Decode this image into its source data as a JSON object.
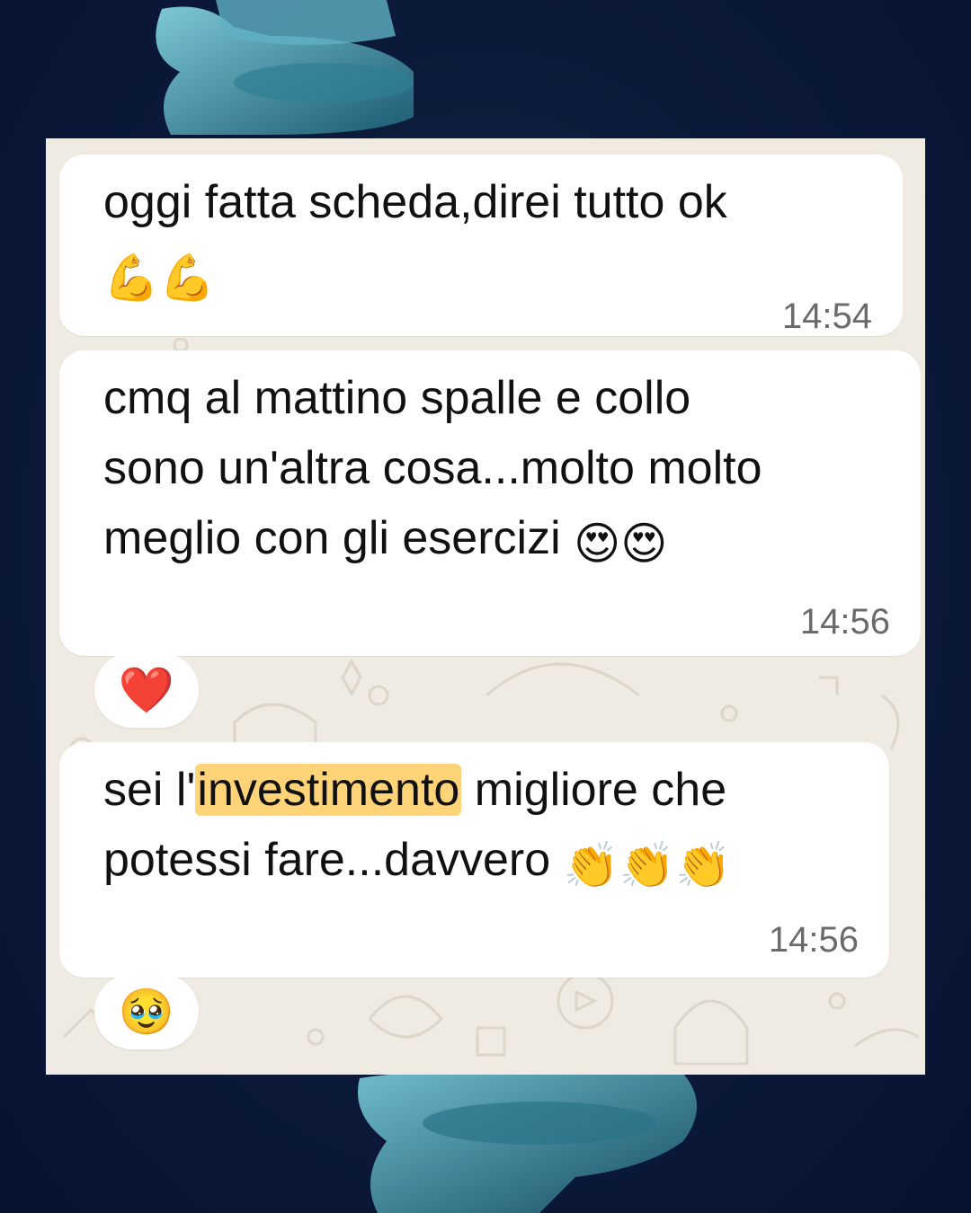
{
  "messages": [
    {
      "text": "oggi fatta scheda,direi tutto  ok",
      "emoji": "💪💪",
      "time": "14:54"
    },
    {
      "text": "cmq al mattino spalle e collo\nsono un'altra cosa...molto molto\nmeglio con gli esercizi",
      "emoji": "😍😍",
      "time": "14:56",
      "reaction": "❤️"
    },
    {
      "text_before": "sei l'",
      "highlight": "investimento",
      "text_after": " migliore che\npotessi fare...davvero",
      "emoji": "👏👏👏",
      "time": "14:56",
      "reaction": "🥹"
    }
  ],
  "colors": {
    "background": "#0c1a3a",
    "chat_wallpaper": "#efeae2",
    "bubble": "#ffffff",
    "highlight": "#ffd479",
    "timestamp": "#6b6b6b"
  }
}
